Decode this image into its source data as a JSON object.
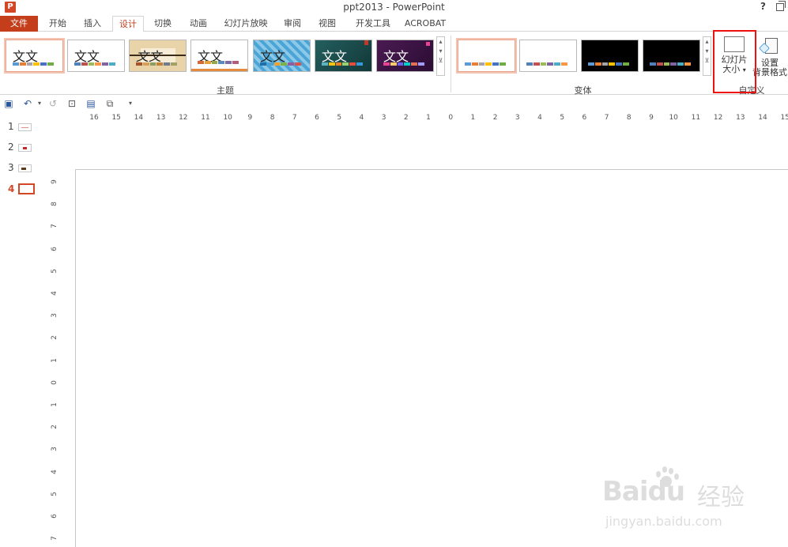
{
  "window": {
    "app_icon_letter": "P",
    "title": "ppt2013 - PowerPoint",
    "help": "?"
  },
  "tabs": [
    "文件",
    "开始",
    "插入",
    "设计",
    "切换",
    "动画",
    "幻灯片放映",
    "审阅",
    "视图",
    "开发工具",
    "ACROBAT"
  ],
  "active_tab": "设计",
  "ribbon": {
    "themes_group_label": "主题",
    "variants_group_label": "变体",
    "customize_group_label": "自定义",
    "theme_sample_text": "文文",
    "slide_size_label_1": "幻灯片",
    "slide_size_label_2": "大小",
    "dropdown_arrow": "▾",
    "bg_format_label_1": "设置",
    "bg_format_label_2": "背景格式"
  },
  "theme_bar_colors": [
    "#4f81bd",
    "#c0504d",
    "#9bbb59",
    "#f79646",
    "#8064a2",
    "#4bacc6"
  ],
  "accent_color": "#d24726",
  "highlight_color": "#ee1111",
  "slides": [
    {
      "num": "1"
    },
    {
      "num": "2"
    },
    {
      "num": "3"
    },
    {
      "num": "4"
    }
  ],
  "hruler_labels": [
    "16",
    "15",
    "14",
    "13",
    "12",
    "11",
    "10",
    "9",
    "8",
    "7",
    "6",
    "5",
    "4",
    "3",
    "2",
    "1",
    "0",
    "1",
    "2",
    "3",
    "4",
    "5",
    "6",
    "7",
    "8",
    "9",
    "10",
    "11",
    "12",
    "13",
    "14",
    "15"
  ],
  "vruler_labels": [
    "9",
    "8",
    "7",
    "6",
    "5",
    "4",
    "3",
    "2",
    "1",
    "0",
    "1",
    "2",
    "3",
    "4",
    "5",
    "6",
    "7"
  ],
  "watermark": {
    "logo": "Bai",
    "logo2": "du",
    "jingyan": "经验",
    "url": "jingyan.baidu.com"
  }
}
